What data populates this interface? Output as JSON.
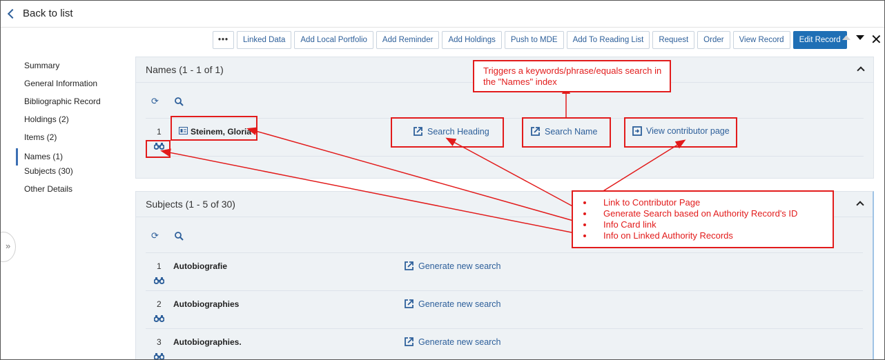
{
  "topbar": {
    "back_label": "Back to list"
  },
  "toolbar": {
    "more_label": "•••",
    "buttons": [
      "Linked Data",
      "Add Local Portfolio",
      "Add Reminder",
      "Add Holdings",
      "Push to MDE",
      "Add To Reading List",
      "Request",
      "Order",
      "View Record"
    ],
    "primary_label": "Edit Record",
    "close_label": "✕"
  },
  "sidebar": {
    "items": [
      {
        "label": "Summary"
      },
      {
        "label": "General Information"
      },
      {
        "label": "Bibliographic Record"
      },
      {
        "label": "Holdings (2)"
      },
      {
        "label": "Items (2)"
      },
      {
        "label": "Names (1)",
        "active": true
      },
      {
        "label": "Subjects (30)"
      },
      {
        "label": "Other Details"
      }
    ],
    "expand_glyph": "»"
  },
  "names_panel": {
    "title": "Names (1 - 1 of 1)",
    "rows": [
      {
        "num": "1",
        "name": "Steinem, Gloria",
        "links": [
          "Search Heading",
          "Search Name",
          "View contributor page"
        ]
      }
    ]
  },
  "subjects_panel": {
    "title": "Subjects (1 - 5 of 30)",
    "rows": [
      {
        "num": "1",
        "name": "Autobiografie",
        "link": "Generate new search"
      },
      {
        "num": "2",
        "name": "Autobiographies",
        "link": "Generate new search"
      },
      {
        "num": "3",
        "name": "Autobiographies.",
        "link": "Generate new search"
      }
    ]
  },
  "annotations": {
    "search_callout_line1": "Triggers a keywords/phrase/equals search in",
    "search_callout_line2": "the \"Names\" index",
    "legend": [
      "Link to Contributor Page",
      "Generate Search based on Authority Record's ID",
      "Info Card link",
      "Info on Linked Authority Records"
    ]
  },
  "colors": {
    "accent": "#1f6fb5",
    "link": "#2d5f9a",
    "annotation": "#e21b1b",
    "panel_bg": "#eef2f5"
  }
}
